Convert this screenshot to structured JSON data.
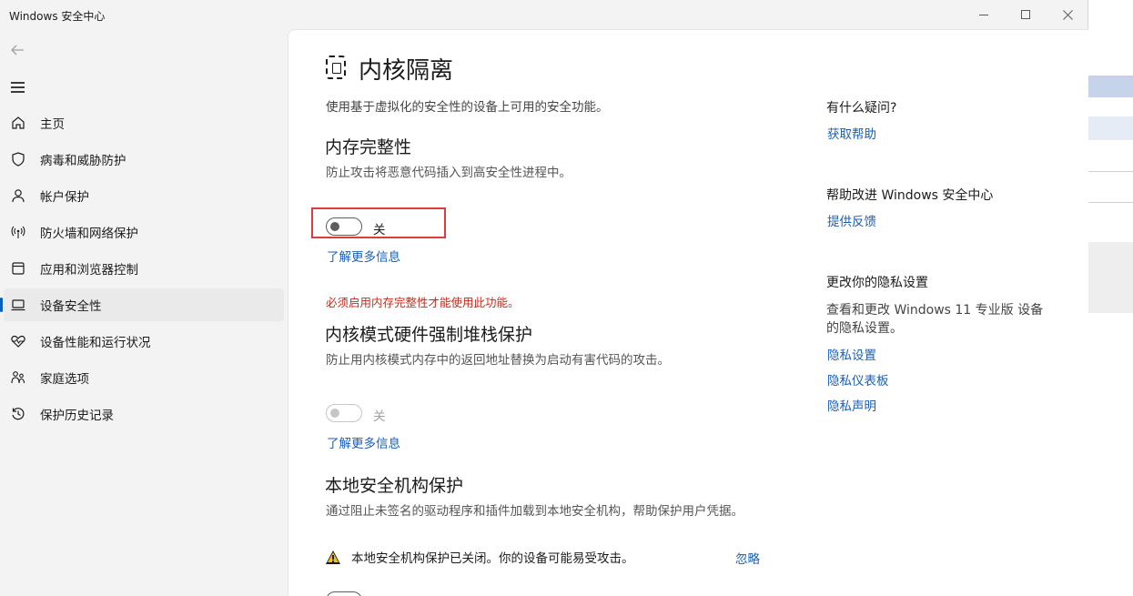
{
  "window": {
    "title": "Windows 安全中心"
  },
  "nav": {
    "items": [
      {
        "label": "主页",
        "icon": "home-icon",
        "active": false
      },
      {
        "label": "病毒和威胁防护",
        "icon": "shield-icon",
        "active": false
      },
      {
        "label": "帐户保护",
        "icon": "person-icon",
        "active": false
      },
      {
        "label": "防火墙和网络保护",
        "icon": "wifi-antenna-icon",
        "active": false
      },
      {
        "label": "应用和浏览器控制",
        "icon": "app-window-icon",
        "active": false
      },
      {
        "label": "设备安全性",
        "icon": "laptop-icon",
        "active": true
      },
      {
        "label": "设备性能和运行状况",
        "icon": "heart-pulse-icon",
        "active": false
      },
      {
        "label": "家庭选项",
        "icon": "family-icon",
        "active": false
      },
      {
        "label": "保护历史记录",
        "icon": "history-icon",
        "active": false
      }
    ]
  },
  "page": {
    "title": "内核隔离",
    "description": "使用基于虚拟化的安全性的设备上可用的安全功能。"
  },
  "memory_integrity": {
    "title": "内存完整性",
    "description": "防止攻击将恶意代码插入到高安全性进程中。",
    "toggle_label": "关",
    "learn_more": "了解更多信息",
    "warning": "必须启用内存完整性才能使用此功能。"
  },
  "stack_protection": {
    "title": "内核模式硬件强制堆栈保护",
    "description": "防止用内核模式内存中的返回地址替换为启动有害代码的攻击。",
    "toggle_label": "关",
    "learn_more": "了解更多信息"
  },
  "lsa_protection": {
    "title": "本地安全机构保护",
    "description": "通过阻止未签名的驱动程序和插件加载到本地安全机构，帮助保护用户凭据。",
    "warning_message": "本地安全机构保护已关闭。你的设备可能易受攻击。",
    "ignore": "忽略"
  },
  "sidebar": {
    "questions_title": "有什么疑问?",
    "get_help": "获取帮助",
    "improve_title": "帮助改进 Windows 安全中心",
    "feedback": "提供反馈",
    "privacy_title": "更改你的隐私设置",
    "privacy_desc": "查看和更改 Windows 11 专业版 设备的隐私设置。",
    "privacy_settings": "隐私设置",
    "privacy_dashboard": "隐私仪表板",
    "privacy_statement": "隐私声明"
  },
  "colors": {
    "accent": "#005fb8",
    "link": "#1a5fb4",
    "error": "#c42b1c",
    "highlight": "#e0393e"
  }
}
